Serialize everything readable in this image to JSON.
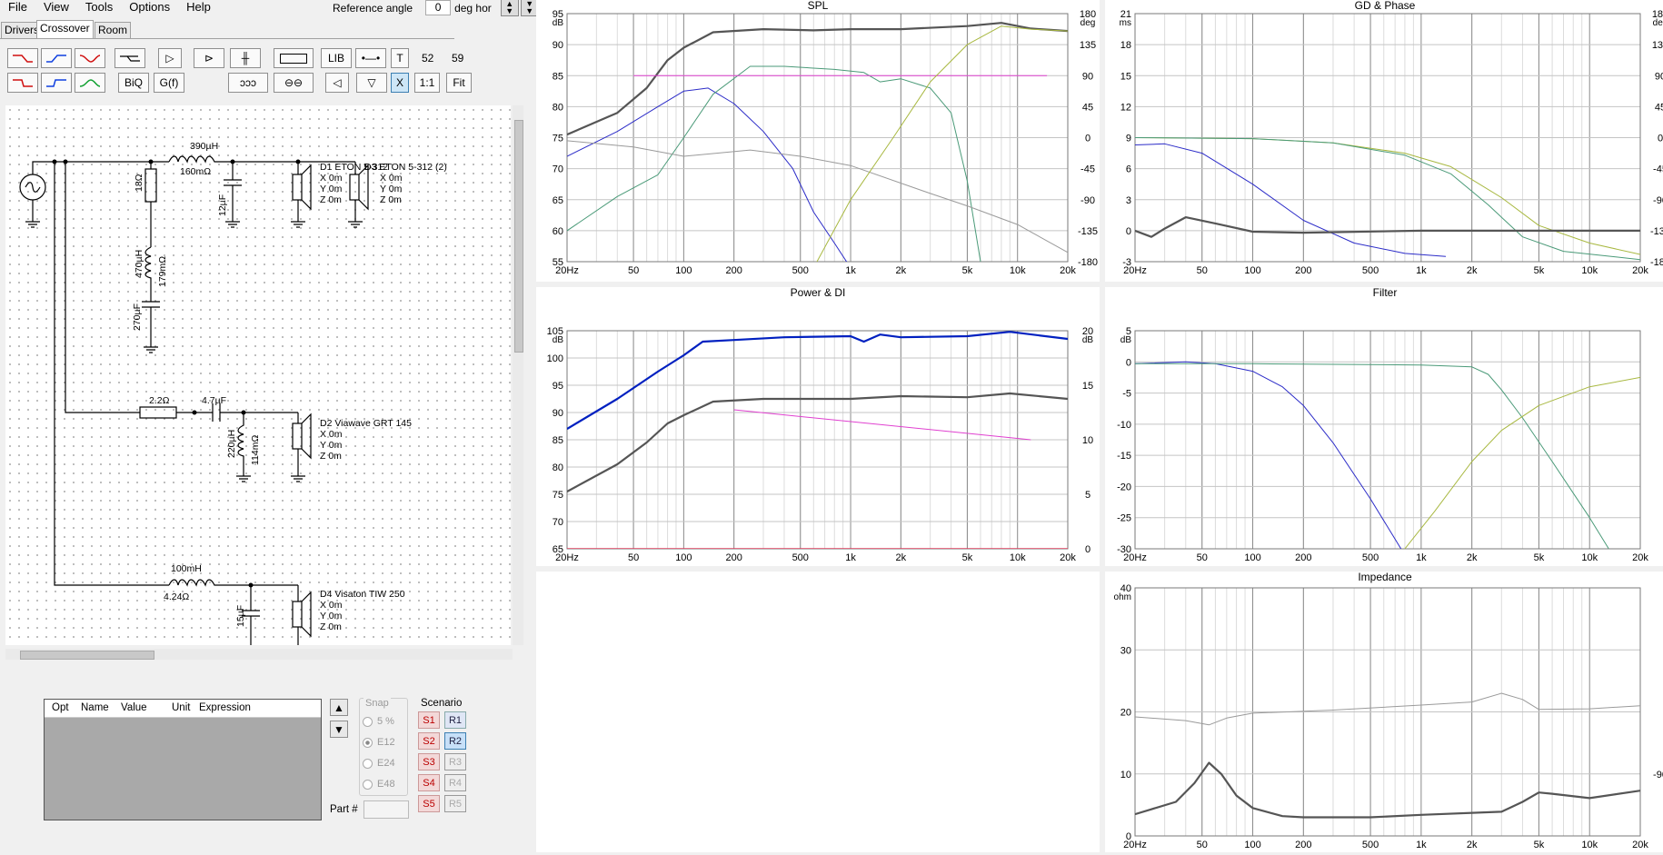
{
  "menu": [
    "File",
    "View",
    "Tools",
    "Options",
    "Help"
  ],
  "reference": {
    "label": "Reference angle",
    "value": "0",
    "unit": "deg hor"
  },
  "tabs": [
    "Drivers",
    "Crossover",
    "Room"
  ],
  "toolbar": {
    "lib": "LIB",
    "t": "T",
    "biq": "BiQ",
    "gf": "G(f)",
    "x": "X",
    "one_to_one": "1:1",
    "fit": "Fit",
    "num1": "52",
    "num2": "59"
  },
  "schematic": {
    "components": [
      "390µH",
      "160mΩ",
      "18Ω",
      "12µF",
      "470µH",
      "179mΩ",
      "270µF",
      "2.2Ω",
      "4.7µF",
      "220µH",
      "114mΩ",
      "100mH",
      "4.24Ω",
      "15µF"
    ],
    "drivers": [
      {
        "name": "D1 ETON 5-312",
        "lines": [
          "X 0m",
          "Y 0m",
          "Z 0m"
        ]
      },
      {
        "name": "D3 ETON 5-312 (2)",
        "lines": [
          "X 0m",
          "Y 0m",
          "Z 0m"
        ]
      },
      {
        "name": "D2 Viawave GRT 145",
        "lines": [
          "X 0m",
          "Y 0m",
          "Z 0m"
        ]
      },
      {
        "name": "D4 Visaton TIW 250",
        "lines": [
          "X 0m",
          "Y 0m",
          "Z 0m"
        ]
      }
    ]
  },
  "params": {
    "columns": [
      "Opt",
      "Name",
      "Value",
      "Unit",
      "Expression"
    ]
  },
  "snap": {
    "label": "Snap",
    "options": [
      "5 %",
      "E12",
      "E24",
      "E48"
    ],
    "selected": "E12"
  },
  "scenario": {
    "label": "Scenario",
    "s": [
      "S1",
      "S2",
      "S3",
      "S4",
      "S5"
    ],
    "r": [
      "R1",
      "R2",
      "R3",
      "R4",
      "R5"
    ],
    "selected_r": "R2"
  },
  "part": {
    "label": "Part #"
  },
  "x_ticks": [
    "20Hz",
    "50",
    "100",
    "200",
    "500",
    "1k",
    "2k",
    "5k",
    "10k",
    "20k"
  ],
  "colors": {
    "blue": "#2c2cc8",
    "gray": "#555555",
    "green": "#4a9a78",
    "olive": "#a8b840",
    "magenta": "#e040d0",
    "lightgray": "#9a9a9a",
    "darkblue": "#0020c0"
  },
  "chart_data": [
    {
      "type": "line",
      "title": "SPL",
      "yunit": "dB",
      "y2unit": "deg",
      "yticks": [
        "95",
        "90",
        "85",
        "80",
        "75",
        "70",
        "65",
        "60",
        "55"
      ],
      "y2ticks": [
        "180",
        "135",
        "90",
        "45",
        "0",
        "-45",
        "-90",
        "-135",
        "-180"
      ],
      "ylim": [
        55,
        95
      ],
      "xlim": [
        20,
        20000
      ],
      "xscale": "log",
      "series": [
        {
          "color": "gray",
          "width": 2.2,
          "points": [
            [
              20,
              75.5
            ],
            [
              40,
              79
            ],
            [
              60,
              83
            ],
            [
              80,
              87.5
            ],
            [
              100,
              89.5
            ],
            [
              150,
              92
            ],
            [
              300,
              92.5
            ],
            [
              600,
              92.3
            ],
            [
              1000,
              92.5
            ],
            [
              2000,
              92.5
            ],
            [
              5000,
              93
            ],
            [
              8000,
              93.5
            ],
            [
              12000,
              92.6
            ],
            [
              20000,
              92.2
            ]
          ]
        },
        {
          "color": "blue",
          "width": 1,
          "points": [
            [
              20,
              72
            ],
            [
              40,
              76
            ],
            [
              70,
              80
            ],
            [
              100,
              82.5
            ],
            [
              140,
              83
            ],
            [
              200,
              80.5
            ],
            [
              300,
              76
            ],
            [
              450,
              70
            ],
            [
              600,
              63
            ],
            [
              800,
              58
            ],
            [
              1000,
              54
            ]
          ]
        },
        {
          "color": "green",
          "width": 1,
          "points": [
            [
              20,
              60
            ],
            [
              40,
              65.5
            ],
            [
              70,
              69
            ],
            [
              100,
              75
            ],
            [
              150,
              82
            ],
            [
              250,
              86.5
            ],
            [
              400,
              86.5
            ],
            [
              800,
              86
            ],
            [
              1200,
              85.5
            ],
            [
              1500,
              84
            ],
            [
              2000,
              84.5
            ],
            [
              3000,
              83
            ],
            [
              4000,
              79
            ],
            [
              5000,
              68
            ],
            [
              6000,
              55
            ]
          ]
        },
        {
          "color": "magenta",
          "width": 1,
          "points": [
            [
              50,
              85
            ],
            [
              15000,
              85
            ]
          ]
        },
        {
          "color": "lightgray",
          "width": 1,
          "points": [
            [
              20,
              74.5
            ],
            [
              50,
              73.5
            ],
            [
              100,
              72
            ],
            [
              250,
              73
            ],
            [
              500,
              72
            ],
            [
              1000,
              70.5
            ],
            [
              3000,
              66
            ],
            [
              5000,
              64
            ],
            [
              10000,
              61
            ],
            [
              20000,
              56.5
            ]
          ]
        },
        {
          "color": "olive",
          "width": 1,
          "points": [
            [
              600,
              54
            ],
            [
              1000,
              65
            ],
            [
              1800,
              75
            ],
            [
              3000,
              84
            ],
            [
              5000,
              90
            ],
            [
              8000,
              93
            ],
            [
              12000,
              92.5
            ],
            [
              20000,
              92.2
            ]
          ]
        }
      ]
    },
    {
      "type": "line",
      "title": "GD & Phase",
      "yunit": "ms",
      "y2unit": "deg",
      "yticks": [
        "21",
        "18",
        "15",
        "12",
        "9",
        "6",
        "3",
        "0",
        "-3"
      ],
      "y2ticks": [
        "180",
        "135",
        "90",
        "45",
        "0",
        "-45",
        "-90",
        "-135",
        "-180"
      ],
      "ylim": [
        -3,
        21
      ],
      "xlim": [
        20,
        20000
      ],
      "xscale": "log",
      "series": [
        {
          "color": "blue",
          "width": 1,
          "points": [
            [
              20,
              8.3
            ],
            [
              30,
              8.4
            ],
            [
              50,
              7.5
            ],
            [
              100,
              4.5
            ],
            [
              200,
              1
            ],
            [
              400,
              -1.2
            ],
            [
              800,
              -2.2
            ],
            [
              1400,
              -2.5
            ]
          ]
        },
        {
          "color": "olive",
          "width": 1,
          "points": [
            [
              20,
              9
            ],
            [
              100,
              8.9
            ],
            [
              300,
              8.5
            ],
            [
              800,
              7.5
            ],
            [
              1500,
              6.2
            ],
            [
              3000,
              3.2
            ],
            [
              5000,
              0.5
            ],
            [
              10000,
              -1.2
            ],
            [
              20000,
              -2.3
            ]
          ]
        },
        {
          "color": "green",
          "width": 1,
          "points": [
            [
              20,
              9
            ],
            [
              100,
              8.9
            ],
            [
              300,
              8.5
            ],
            [
              800,
              7.3
            ],
            [
              1500,
              5.5
            ],
            [
              2500,
              2.5
            ],
            [
              4000,
              -0.6
            ],
            [
              7000,
              -2
            ],
            [
              20000,
              -2.8
            ]
          ]
        },
        {
          "color": "gray",
          "width": 2.2,
          "points": [
            [
              20,
              0
            ],
            [
              25,
              -0.6
            ],
            [
              30,
              0.2
            ],
            [
              40,
              1.3
            ],
            [
              60,
              0.7
            ],
            [
              100,
              -0.1
            ],
            [
              200,
              -0.2
            ],
            [
              1000,
              0
            ],
            [
              20000,
              0
            ]
          ]
        }
      ]
    },
    {
      "type": "line",
      "title": "Power & DI",
      "yunit": "dB",
      "y2unit": "dB",
      "yticks": [
        "105",
        "100",
        "95",
        "90",
        "85",
        "80",
        "75",
        "70",
        "65"
      ],
      "y2ticks": [
        "20",
        "15",
        "10",
        "5",
        "0"
      ],
      "ylim": [
        65,
        105
      ],
      "xlim": [
        20,
        20000
      ],
      "xscale": "log",
      "series": [
        {
          "color": "darkblue",
          "width": 2.2,
          "points": [
            [
              20,
              87
            ],
            [
              40,
              92.5
            ],
            [
              70,
              97.5
            ],
            [
              100,
              100.5
            ],
            [
              130,
              103
            ],
            [
              200,
              103.3
            ],
            [
              400,
              103.8
            ],
            [
              1000,
              104
            ],
            [
              1200,
              103
            ],
            [
              1500,
              104.3
            ],
            [
              2000,
              103.8
            ],
            [
              5000,
              104
            ],
            [
              9000,
              104.8
            ],
            [
              20000,
              103.5
            ]
          ]
        },
        {
          "color": "gray",
          "width": 2.2,
          "points": [
            [
              20,
              75.5
            ],
            [
              40,
              80.5
            ],
            [
              60,
              84.5
            ],
            [
              80,
              88
            ],
            [
              100,
              89.5
            ],
            [
              150,
              92
            ],
            [
              300,
              92.5
            ],
            [
              1000,
              92.5
            ],
            [
              2000,
              93
            ],
            [
              5000,
              92.8
            ],
            [
              9000,
              93.5
            ],
            [
              20000,
              92.5
            ]
          ]
        },
        {
          "color": "magenta",
          "width": 1,
          "points": [
            [
              200,
              90.5
            ],
            [
              12000,
              85
            ]
          ]
        },
        {
          "color": "#e04060",
          "width": 1.5,
          "points": [
            [
              20,
              65
            ],
            [
              20000,
              65
            ]
          ]
        }
      ]
    },
    {
      "type": "line",
      "title": "Filter",
      "yunit": "dB",
      "yticks": [
        "5",
        "0",
        "-5",
        "-10",
        "-15",
        "-20",
        "-25",
        "-30"
      ],
      "ylim": [
        -30,
        5
      ],
      "xlim": [
        20,
        20000
      ],
      "xscale": "log",
      "series": [
        {
          "color": "blue",
          "width": 1,
          "points": [
            [
              20,
              -0.3
            ],
            [
              40,
              0
            ],
            [
              60,
              -0.3
            ],
            [
              100,
              -1.5
            ],
            [
              150,
              -4
            ],
            [
              200,
              -7
            ],
            [
              300,
              -13
            ],
            [
              500,
              -22
            ],
            [
              800,
              -31
            ]
          ]
        },
        {
          "color": "green",
          "width": 1,
          "points": [
            [
              20,
              -0.3
            ],
            [
              100,
              -0.3
            ],
            [
              1000,
              -0.5
            ],
            [
              2000,
              -0.8
            ],
            [
              2500,
              -2
            ],
            [
              3000,
              -4.5
            ],
            [
              4000,
              -9
            ],
            [
              6000,
              -16
            ],
            [
              10000,
              -25
            ],
            [
              13000,
              -30
            ]
          ]
        },
        {
          "color": "olive",
          "width": 1,
          "points": [
            [
              800,
              -30
            ],
            [
              1200,
              -24
            ],
            [
              2000,
              -16
            ],
            [
              3000,
              -11
            ],
            [
              5000,
              -7
            ],
            [
              10000,
              -4
            ],
            [
              20000,
              -2.5
            ]
          ]
        }
      ]
    },
    {
      "type": "line",
      "title": "Impedance",
      "yunit": "ohm",
      "yticks": [
        "40",
        "30",
        "20",
        "10",
        "0"
      ],
      "y2ticks": [
        "-90"
      ],
      "ylim": [
        0,
        40
      ],
      "xlim": [
        20,
        20000
      ],
      "xscale": "log",
      "series": [
        {
          "color": "lightgray",
          "width": 1,
          "points": [
            [
              20,
              19.2
            ],
            [
              40,
              18.6
            ],
            [
              55,
              17.9
            ],
            [
              70,
              19
            ],
            [
              100,
              19.8
            ],
            [
              300,
              20.3
            ],
            [
              1000,
              21.1
            ],
            [
              2000,
              21.6
            ],
            [
              3000,
              23
            ],
            [
              4000,
              22
            ],
            [
              5000,
              20.4
            ],
            [
              10000,
              20.5
            ],
            [
              20000,
              21
            ]
          ]
        },
        {
          "color": "gray",
          "width": 2.2,
          "points": [
            [
              20,
              3.5
            ],
            [
              35,
              5.5
            ],
            [
              45,
              8.5
            ],
            [
              55,
              11.8
            ],
            [
              65,
              10
            ],
            [
              80,
              6.5
            ],
            [
              100,
              4.5
            ],
            [
              150,
              3.2
            ],
            [
              200,
              3
            ],
            [
              500,
              3
            ],
            [
              1000,
              3.4
            ],
            [
              3000,
              3.9
            ],
            [
              4000,
              5.5
            ],
            [
              5000,
              7
            ],
            [
              6000,
              6.8
            ],
            [
              10000,
              6.1
            ],
            [
              20000,
              7.3
            ]
          ]
        }
      ]
    }
  ]
}
